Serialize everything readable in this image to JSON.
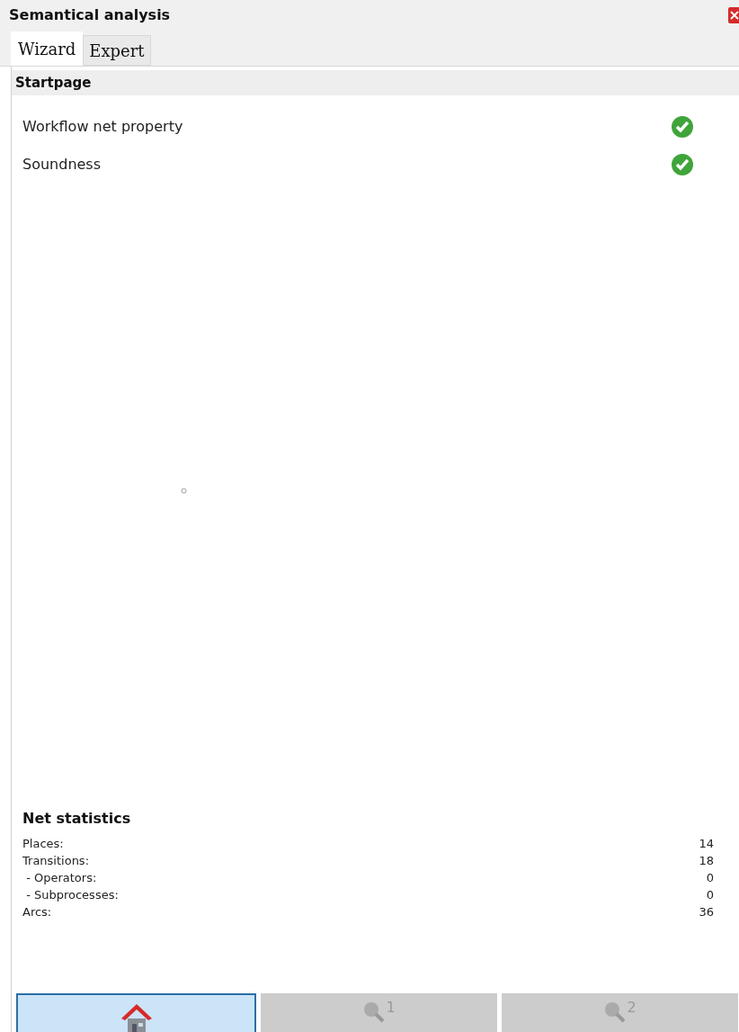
{
  "window": {
    "title": "Semantical analysis"
  },
  "tabs": [
    {
      "label": "Wizard",
      "selected": true
    },
    {
      "label": "Expert",
      "selected": false
    }
  ],
  "page": {
    "title": "Startpage"
  },
  "checks": [
    {
      "label": "Workflow net property",
      "passed": true
    },
    {
      "label": "Soundness",
      "passed": true
    }
  ],
  "statistics": {
    "title": "Net statistics",
    "rows": [
      {
        "label": "Places:",
        "value": "14"
      },
      {
        "label": "Transitions:",
        "value": "18"
      },
      {
        "label": " - Operators:",
        "value": "0"
      },
      {
        "label": " - Subprocesses:",
        "value": "0"
      },
      {
        "label": "Arcs:",
        "value": "36"
      }
    ]
  },
  "buttons": [
    {
      "kind": "home",
      "selected": true
    },
    {
      "kind": "search",
      "label": "1",
      "selected": false
    },
    {
      "kind": "search",
      "label": "2",
      "selected": false
    }
  ]
}
